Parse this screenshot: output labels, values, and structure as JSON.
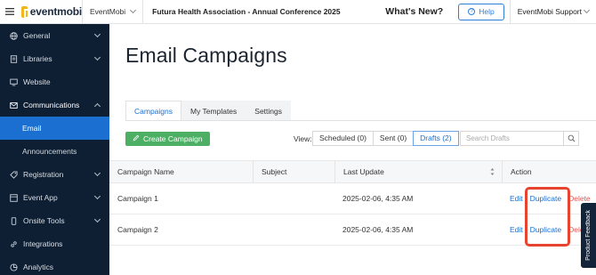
{
  "topbar": {
    "logo_text": "eventmobi",
    "org": "EventMobi",
    "event": "Futura Health Association - Annual Conference 2025",
    "whats_new": "What's New?",
    "help": "Help",
    "account": "EventMobi Support"
  },
  "sidebar": {
    "items": [
      {
        "label": "General",
        "icon": "globe-icon"
      },
      {
        "label": "Libraries",
        "icon": "book-icon"
      },
      {
        "label": "Website",
        "icon": "monitor-icon"
      },
      {
        "label": "Communications",
        "icon": "mail-icon"
      },
      {
        "label": "Registration",
        "icon": "tag-icon"
      },
      {
        "label": "Event App",
        "icon": "app-icon"
      },
      {
        "label": "Onsite Tools",
        "icon": "phone-icon"
      },
      {
        "label": "Integrations",
        "icon": "link-icon"
      },
      {
        "label": "Analytics",
        "icon": "chart-icon"
      }
    ],
    "sub_items": [
      {
        "label": "Email"
      },
      {
        "label": "Announcements"
      }
    ]
  },
  "page": {
    "title": "Email Campaigns",
    "tabs": [
      {
        "label": "Campaigns"
      },
      {
        "label": "My Templates"
      },
      {
        "label": "Settings"
      }
    ],
    "create_label": "Create Campaign",
    "view_label": "View:",
    "view_options": [
      {
        "label": "Scheduled (0)"
      },
      {
        "label": "Sent (0)"
      },
      {
        "label": "Drafts (2)"
      }
    ],
    "search_placeholder": "Search Drafts"
  },
  "table": {
    "columns": [
      "Campaign Name",
      "Subject",
      "Last Update",
      "Action"
    ],
    "rows": [
      {
        "name": "Campaign 1",
        "subject": "",
        "updated": "2025-02-06, 4:35 AM",
        "edit": "Edit",
        "duplicate": "Duplicate",
        "delete": "Delete"
      },
      {
        "name": "Campaign 2",
        "subject": "",
        "updated": "2025-02-06, 4:35 AM",
        "edit": "Edit",
        "duplicate": "Duplicate",
        "delete": "Delete"
      }
    ]
  },
  "feedback": "Product Feedback",
  "colors": {
    "sidebar_bg": "#0f1f33",
    "accent": "#1a6fd1",
    "create_green": "#4caf64",
    "highlight_red": "#e8432f"
  }
}
